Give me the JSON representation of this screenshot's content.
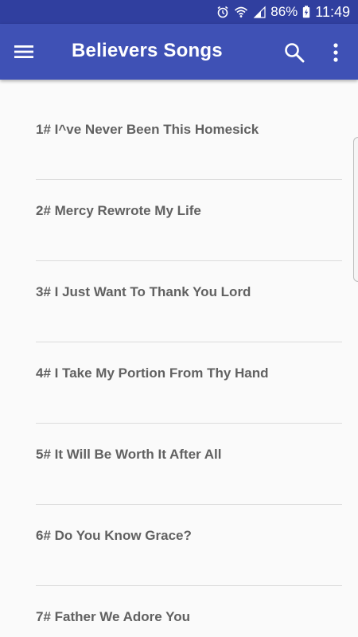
{
  "status_bar": {
    "battery_percent": "86%",
    "time": "11:49",
    "icons": [
      "alarm-icon",
      "wifi-icon",
      "signal-icon",
      "battery-charging-icon"
    ]
  },
  "app_bar": {
    "title": "Believers Songs",
    "icons": [
      "menu-icon",
      "search-icon",
      "more-vert-icon"
    ]
  },
  "songs": [
    "1# I^ve Never Been This Homesick",
    "2# Mercy Rewrote My Life",
    "3# I Just Want To Thank You Lord",
    "4# I Take My Portion From Thy Hand",
    "5# It Will Be Worth It After All",
    "6# Do You Know Grace?",
    "7# Father We Adore You"
  ],
  "colors": {
    "status_bar": "#303f9f",
    "app_bar": "#3f51b5",
    "background": "#fafafa",
    "item_text": "#616161",
    "divider": "#dcdcdc"
  }
}
